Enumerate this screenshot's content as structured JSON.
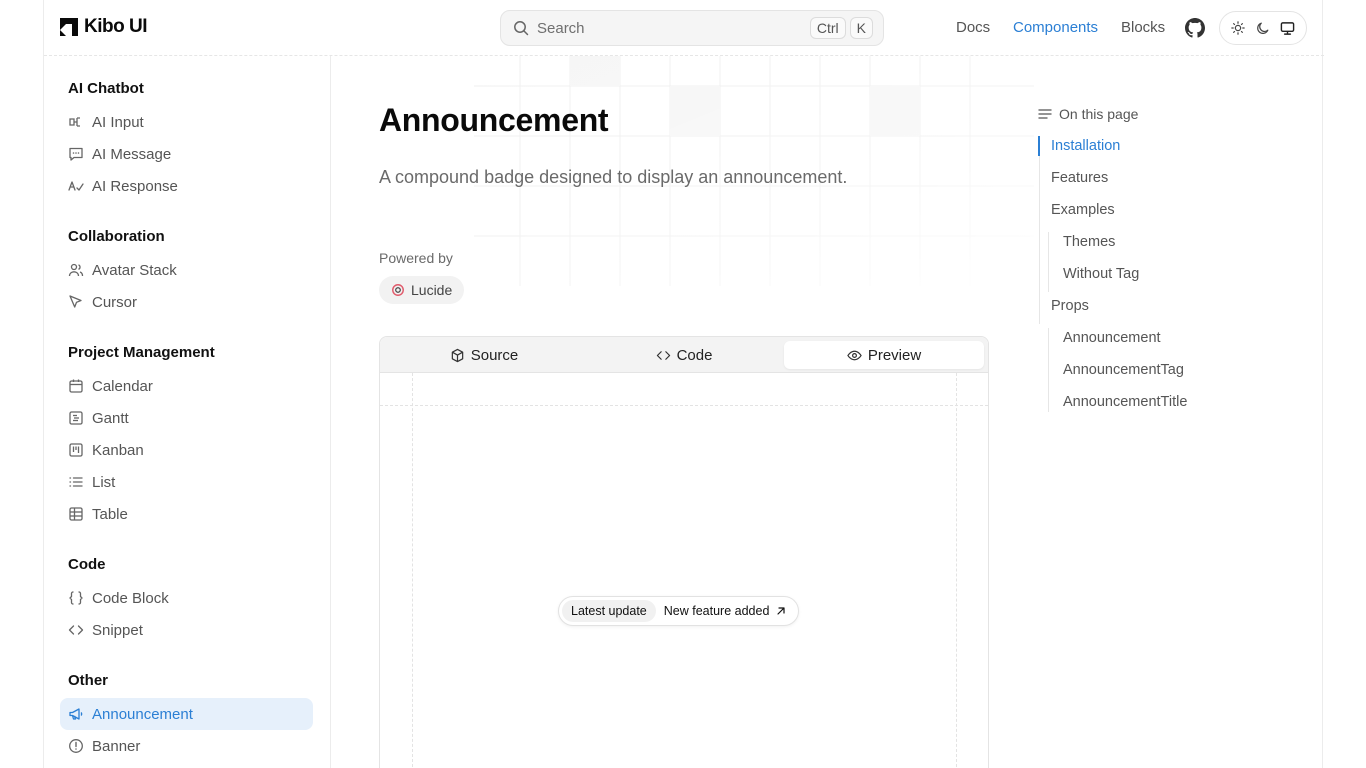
{
  "header": {
    "logo_text": "Kibo UI",
    "search_placeholder": "Search",
    "search_kbd": [
      "Ctrl",
      "K"
    ],
    "nav": [
      {
        "label": "Docs",
        "active": false
      },
      {
        "label": "Components",
        "active": true
      },
      {
        "label": "Blocks",
        "active": false
      }
    ],
    "icons": [
      "github-icon",
      "sun-icon",
      "moon-icon",
      "monitor-icon"
    ]
  },
  "sidebar": {
    "groups": [
      {
        "title": "AI Chatbot",
        "items": [
          {
            "label": "AI Input",
            "icon": "ai-input-icon"
          },
          {
            "label": "AI Message",
            "icon": "message-icon"
          },
          {
            "label": "AI Response",
            "icon": "text-response-icon"
          }
        ]
      },
      {
        "title": "Collaboration",
        "items": [
          {
            "label": "Avatar Stack",
            "icon": "users-icon"
          },
          {
            "label": "Cursor",
            "icon": "pointer-icon"
          }
        ]
      },
      {
        "title": "Project Management",
        "items": [
          {
            "label": "Calendar",
            "icon": "calendar-icon"
          },
          {
            "label": "Gantt",
            "icon": "gantt-icon"
          },
          {
            "label": "Kanban",
            "icon": "kanban-icon"
          },
          {
            "label": "List",
            "icon": "list-icon"
          },
          {
            "label": "Table",
            "icon": "table-icon"
          }
        ]
      },
      {
        "title": "Code",
        "items": [
          {
            "label": "Code Block",
            "icon": "braces-icon"
          },
          {
            "label": "Snippet",
            "icon": "code-icon"
          }
        ]
      },
      {
        "title": "Other",
        "items": [
          {
            "label": "Announcement",
            "icon": "megaphone-icon",
            "active": true
          },
          {
            "label": "Banner",
            "icon": "alert-circle-icon"
          }
        ]
      }
    ]
  },
  "main": {
    "title": "Announcement",
    "description": "A compound badge designed to display an announcement.",
    "powered_by_label": "Powered by",
    "powered_by": "Lucide",
    "tabs": [
      {
        "label": "Source",
        "icon": "box-icon",
        "active": false
      },
      {
        "label": "Code",
        "icon": "code-icon",
        "active": false
      },
      {
        "label": "Preview",
        "icon": "eye-icon",
        "active": true
      }
    ],
    "preview": {
      "tag": "Latest update",
      "title": "New feature added"
    }
  },
  "toc": {
    "heading": "On this page",
    "items": [
      {
        "label": "Installation",
        "level": 1,
        "active": true
      },
      {
        "label": "Features",
        "level": 1
      },
      {
        "label": "Examples",
        "level": 1
      },
      {
        "label": "Themes",
        "level": 2
      },
      {
        "label": "Without Tag",
        "level": 2
      },
      {
        "label": "Props",
        "level": 1
      },
      {
        "label": "Announcement",
        "level": 2
      },
      {
        "label": "AnnouncementTag",
        "level": 2
      },
      {
        "label": "AnnouncementTitle",
        "level": 2
      }
    ]
  },
  "colors": {
    "accent": "#2b7fd4",
    "active_bg": "#e6f0fb"
  }
}
